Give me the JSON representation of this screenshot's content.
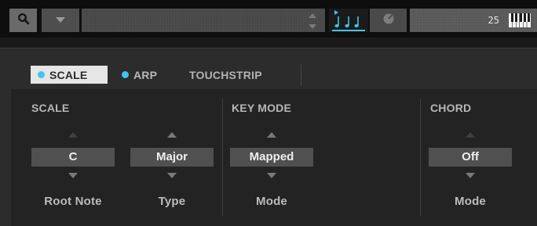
{
  "toolbar": {
    "search_icon": "search-icon",
    "dropdown_icon": "chevron-down-icon",
    "notes_icon": "notes-icon",
    "tempo_icon": "metronome-icon",
    "keyboard_icon": "keyboard-icon",
    "key_count": "25"
  },
  "tabs": [
    {
      "label": "SCALE",
      "active": true,
      "indicator": true
    },
    {
      "label": "ARP",
      "active": false,
      "indicator": true
    },
    {
      "label": "TOUCHSTRIP",
      "active": false,
      "indicator": false
    }
  ],
  "sections": {
    "scale": {
      "title": "SCALE",
      "root_note": {
        "value": "C",
        "label": "Root Note"
      },
      "type": {
        "value": "Major",
        "label": "Type"
      }
    },
    "key_mode": {
      "title": "KEY MODE",
      "mode": {
        "value": "Mapped",
        "label": "Mode"
      }
    },
    "chord": {
      "title": "CHORD",
      "mode": {
        "value": "Off",
        "label": "Mode"
      }
    }
  },
  "colors": {
    "accent": "#3ec6ee",
    "active_tab": "#e6e6e6",
    "value_box": "#505050"
  }
}
